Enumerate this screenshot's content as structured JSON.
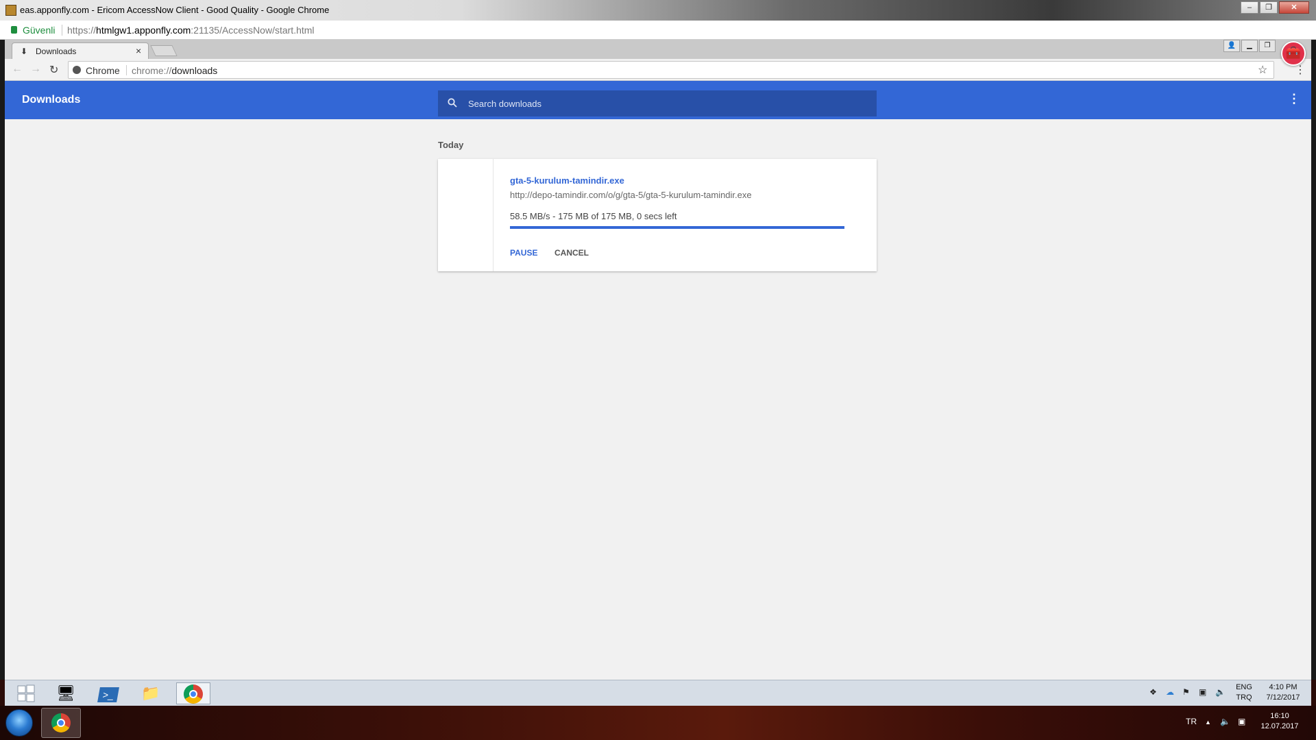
{
  "outer_window": {
    "title": "eas.apponfly.com - Ericom AccessNow Client - Good Quality - Google Chrome",
    "secure_label": "Güvenli",
    "url_scheme": "https://",
    "url_host": "htmlgw1.apponfly.com",
    "url_rest": ":21135/AccessNow/start.html",
    "ctrl_min": "–",
    "ctrl_max": "❐",
    "ctrl_close": "✕"
  },
  "inner_browser": {
    "tab_label": "Downloads",
    "tab_close": "×",
    "omnibox_scheme_label": "Chrome",
    "omnibox_url_prefix": "chrome://",
    "omnibox_url_host": "downloads"
  },
  "downloads": {
    "title": "Downloads",
    "search_placeholder": "Search downloads",
    "section": "Today",
    "item": {
      "filename": "gta-5-kurulum-tamindir.exe",
      "url": "http://depo-tamindir.com/o/g/gta-5/gta-5-kurulum-tamindir.exe",
      "status": "58.5 MB/s - 175 MB of 175 MB, 0 secs left",
      "progress_percent": 100,
      "pause_label": "PAUSE",
      "cancel_label": "CANCEL"
    }
  },
  "remote_taskbar": {
    "lang_top": "ENG",
    "lang_bottom": "TRQ",
    "time": "4:10 PM",
    "date": "7/12/2017"
  },
  "host_taskbar": {
    "lang": "TR",
    "time": "16:10",
    "date": "12.07.2017"
  },
  "colors": {
    "accent": "#3367d6",
    "search_bg": "#2850a8",
    "secure_green": "#1e8e3e"
  }
}
